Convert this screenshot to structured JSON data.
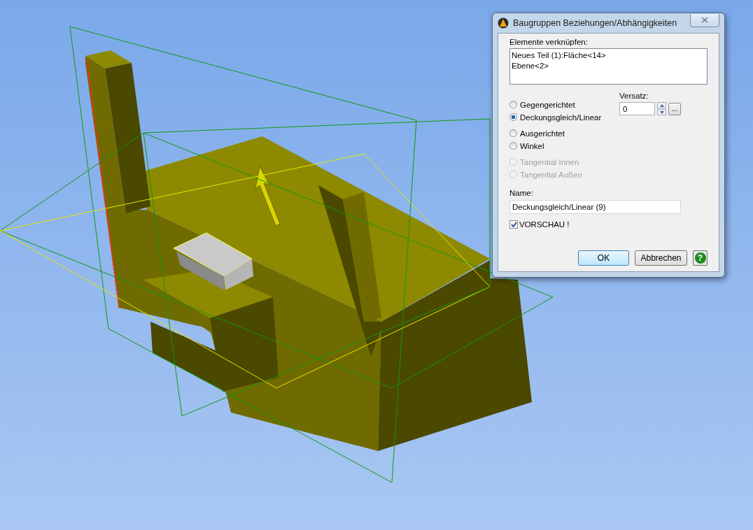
{
  "dialog": {
    "title": "Baugruppen Beziehungen/Abhängigkeiten",
    "elements_label": "Elemente verknüpfen:",
    "elements": [
      "Neues Teil (1):Fläche<14>",
      "Ebene<2>"
    ],
    "radio_groups": [
      {
        "options": [
          {
            "label": "Gegengerichtet",
            "selected": false,
            "disabled": false
          },
          {
            "label": "Deckungsgleich/Linear",
            "selected": true,
            "disabled": false
          }
        ]
      },
      {
        "options": [
          {
            "label": "Ausgerichtet",
            "selected": false,
            "disabled": false
          },
          {
            "label": "Winkel",
            "selected": false,
            "disabled": false
          }
        ]
      },
      {
        "options": [
          {
            "label": "Tangential Innen",
            "selected": false,
            "disabled": true
          },
          {
            "label": "Tangential Außen",
            "selected": false,
            "disabled": true
          }
        ]
      }
    ],
    "offset_label": "Versatz:",
    "offset_value": "0",
    "browse_button": "...",
    "name_label": "Name:",
    "name_value": "Deckungsgleich/Linear (9)",
    "preview": {
      "label": "VORSCHAU !",
      "checked": true
    },
    "buttons": [
      {
        "label": "OK",
        "kind": "default"
      },
      {
        "label": "Abbrechen",
        "kind": "normal"
      },
      {
        "label": "?",
        "kind": "help"
      }
    ]
  }
}
